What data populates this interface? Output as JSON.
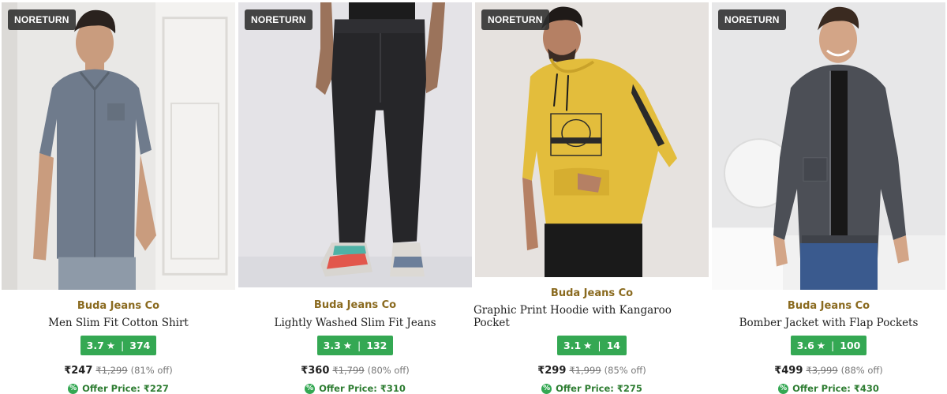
{
  "products": [
    {
      "badge": "NORETURN",
      "brand": "Buda Jeans Co",
      "name": "Men Slim Fit Cotton Shirt",
      "rating": "3.7",
      "star": "★",
      "reviews": "374",
      "price": "₹247",
      "mrp": "₹1,299",
      "discount": "(81% off)",
      "offer_label": "Offer Price: ₹227",
      "image_alt": "Man in grey short-sleeve cotton shirt"
    },
    {
      "badge": "NORETURN",
      "brand": "Buda Jeans Co",
      "name": "Lightly Washed Slim Fit Jeans",
      "rating": "3.3",
      "star": "★",
      "reviews": "132",
      "price": "₹360",
      "mrp": "₹1,799",
      "discount": "(80% off)",
      "offer_label": "Offer Price: ₹310",
      "image_alt": "Black slim fit jeans with sneakers"
    },
    {
      "badge": "NORETURN",
      "brand": "Buda Jeans Co",
      "name": "Graphic Print Hoodie with Kangaroo Pocket",
      "rating": "3.1",
      "star": "★",
      "reviews": "14",
      "price": "₹299",
      "mrp": "₹1,999",
      "discount": "(85% off)",
      "offer_label": "Offer Price: ₹275",
      "image_alt": "Man in yellow graphic print hoodie"
    },
    {
      "badge": "NORETURN",
      "brand": "Buda Jeans Co",
      "name": "Bomber Jacket with Flap Pockets",
      "rating": "3.6",
      "star": "★",
      "reviews": "100",
      "price": "₹499",
      "mrp": "₹3,999",
      "discount": "(88% off)",
      "offer_label": "Offer Price: ₹430",
      "image_alt": "Man in grey bomber jacket"
    }
  ],
  "colors": {
    "badge_bg": "#2d2d2d",
    "brand": "#8a6a1f",
    "rating_bg": "#34a853",
    "offer_text": "#2e7d32"
  }
}
